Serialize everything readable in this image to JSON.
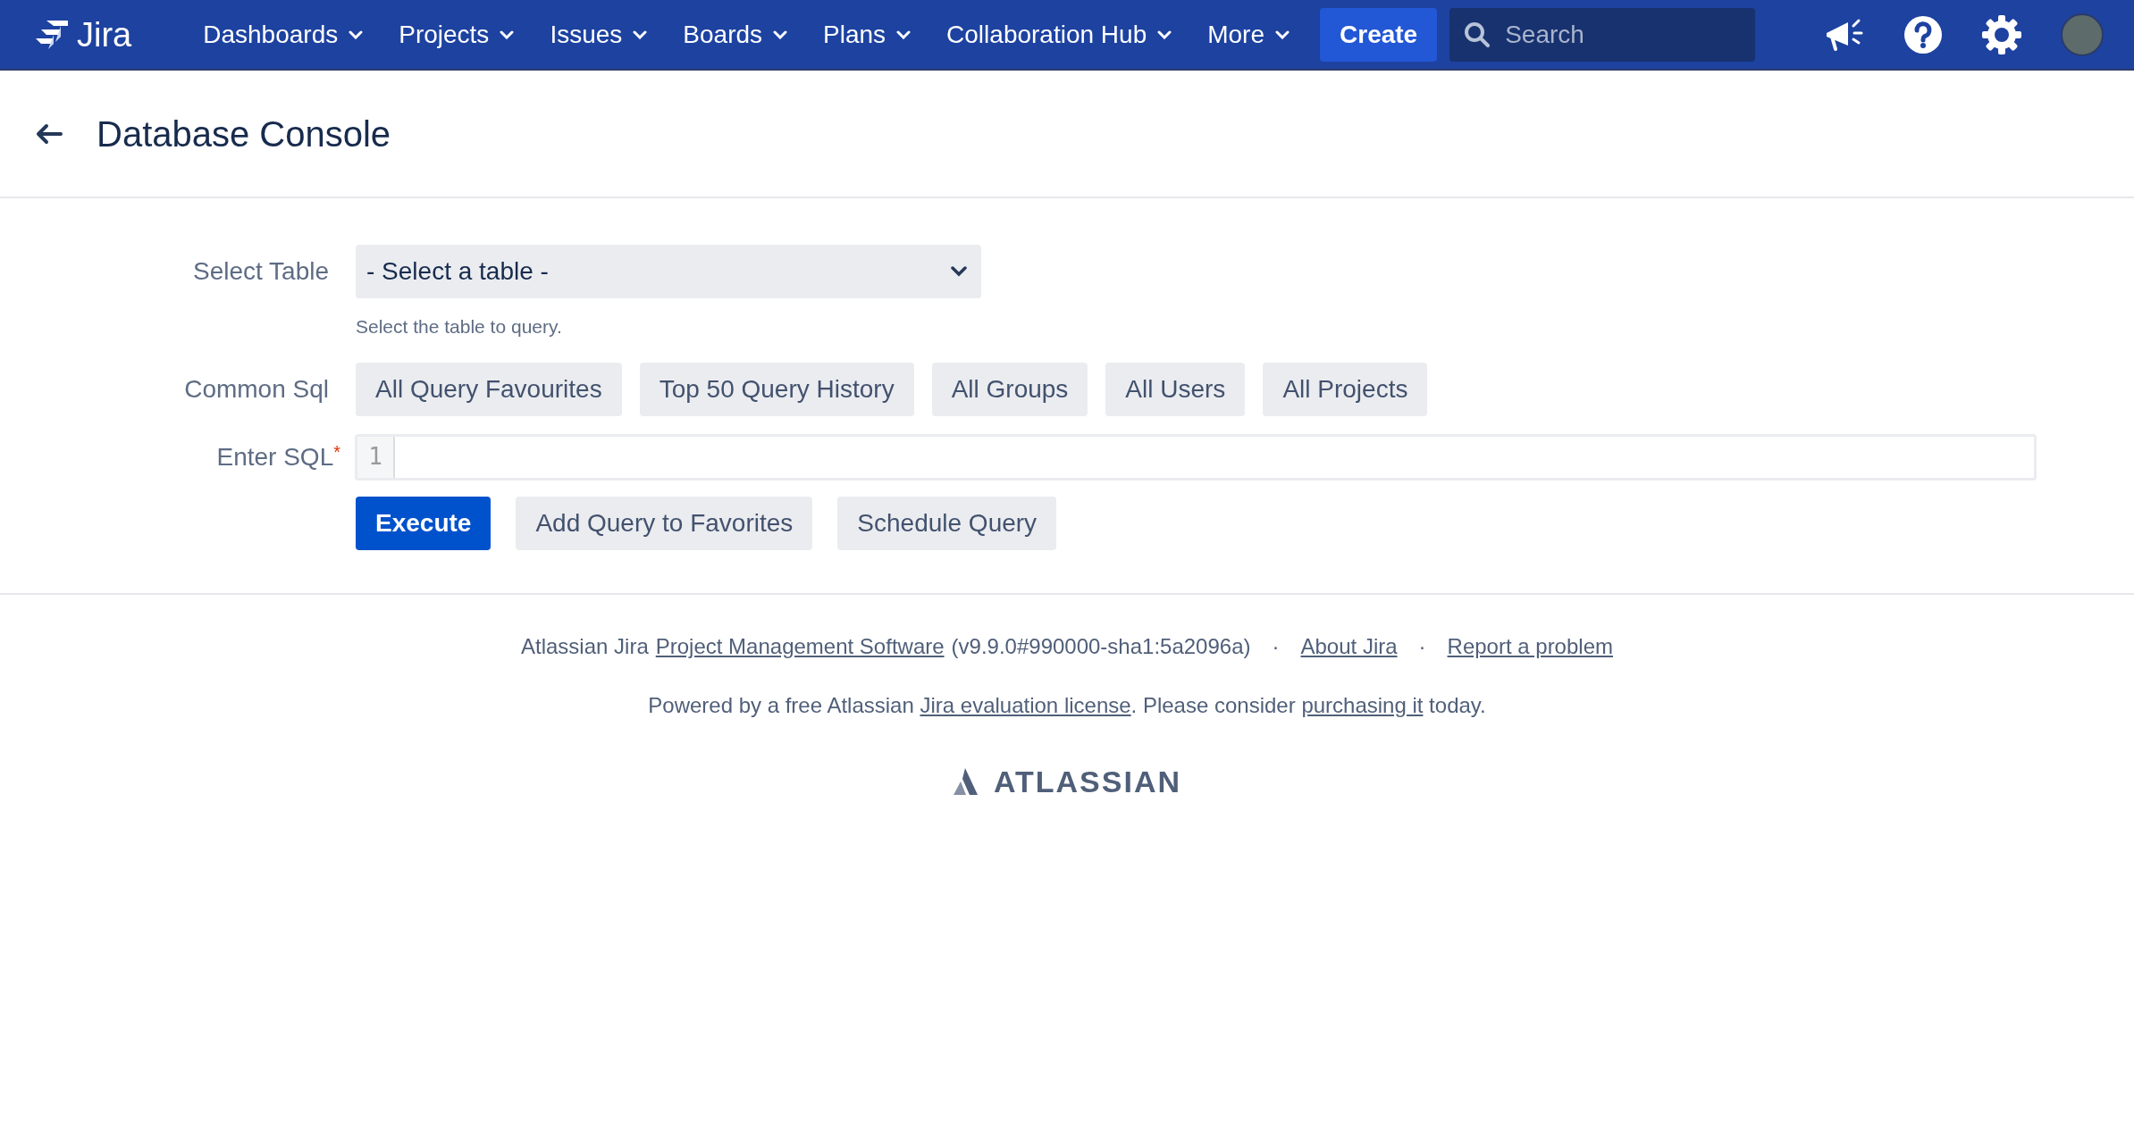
{
  "header": {
    "logo_text": "Jira",
    "nav": [
      {
        "label": "Dashboards"
      },
      {
        "label": "Projects"
      },
      {
        "label": "Issues"
      },
      {
        "label": "Boards"
      },
      {
        "label": "Plans"
      },
      {
        "label": "Collaboration Hub"
      },
      {
        "label": "More"
      }
    ],
    "create_button": "Create",
    "search": {
      "placeholder": "Search"
    }
  },
  "page": {
    "title": "Database Console"
  },
  "form": {
    "select_table": {
      "label": "Select Table",
      "value": "- Select a table -",
      "hint": "Select the table to query."
    },
    "common_sql": {
      "label": "Common Sql",
      "buttons": [
        "All Query Favourites",
        "Top 50 Query History",
        "All Groups",
        "All Users",
        "All Projects"
      ]
    },
    "enter_sql": {
      "label": "Enter SQL",
      "required_mark": "*",
      "line_numbers": [
        "1"
      ]
    },
    "actions": [
      {
        "label": "Execute",
        "kind": "primary"
      },
      {
        "label": "Add Query to Favorites",
        "kind": "default"
      },
      {
        "label": "Schedule Query",
        "kind": "default"
      }
    ]
  },
  "footer": {
    "line_1": [
      {
        "kind": "text",
        "text": "Atlassian Jira"
      },
      {
        "kind": "link",
        "text": "Project Management Software"
      },
      {
        "kind": "text",
        "text": "(v9.9.0#990000-sha1:5a2096a)"
      },
      {
        "kind": "sep",
        "text": "·"
      },
      {
        "kind": "link",
        "text": "About Jira"
      },
      {
        "kind": "sep",
        "text": "·"
      },
      {
        "kind": "link",
        "text": "Report a problem"
      }
    ],
    "line_2": [
      {
        "kind": "text",
        "text": "Powered by a free Atlassian "
      },
      {
        "kind": "link",
        "text": "Jira evaluation license"
      },
      {
        "kind": "text",
        "text": ". Please consider "
      },
      {
        "kind": "link",
        "text": "purchasing it"
      },
      {
        "kind": "text",
        "text": " today."
      }
    ],
    "logo_text": "ATLASSIAN"
  }
}
